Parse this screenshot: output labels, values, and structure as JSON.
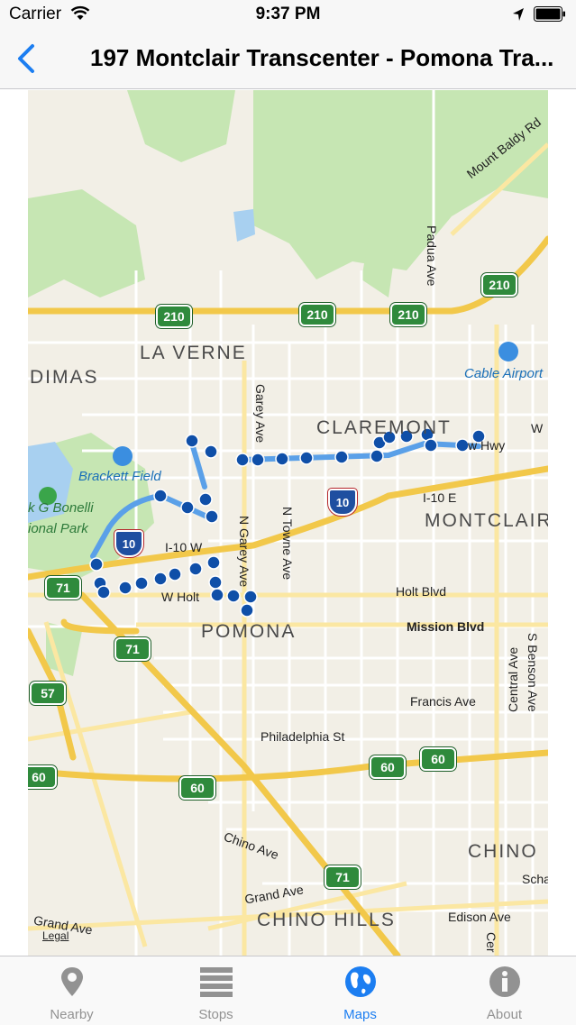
{
  "status_bar": {
    "carrier": "Carrier",
    "time": "9:37 PM",
    "icons": [
      "wifi-icon",
      "location-arrow-icon",
      "battery-icon"
    ]
  },
  "nav": {
    "back_icon": "chevron-left-icon",
    "title": "197 Montclair Transcenter - Pomona Tra..."
  },
  "map": {
    "cities": [
      "LA VERNE",
      "DIMAS",
      "CLAREMONT",
      "MONTCLAIR",
      "POMONA",
      "CHINO",
      "CHINO HILLS"
    ],
    "places": [
      "Brackett Field",
      "Cable Airport",
      "k G Bonelli",
      "ional Park"
    ],
    "roads": [
      "Mount Baldy Rd",
      "Padua Ave",
      "Garey Ave",
      "N Garey Ave",
      "N Towne Ave",
      "I-10 E",
      "I-10 W",
      "W Holt",
      "Holt Blvd",
      "Mission Blvd",
      "Central Ave",
      "S Benson Ave",
      "Francis Ave",
      "Philadelphia St",
      "Chino Ave",
      "Grand Ave",
      "Edison Ave",
      "Grand Ave",
      "Scha",
      "W",
      "w Hwy",
      "Cer"
    ],
    "highway_shields": [
      "210",
      "210",
      "210",
      "210",
      "71",
      "71",
      "57",
      "60",
      "60",
      "60",
      "60",
      "71"
    ],
    "interstate_shields": [
      "10",
      "10"
    ],
    "legal": "Legal",
    "colors": {
      "route": "#0f4fa8",
      "route_line": "#5aa0e8",
      "freeway": "#f6cb45",
      "park": "#c6e6b3",
      "water": "#a8d0f0"
    }
  },
  "tabs": [
    {
      "label": "Nearby",
      "icon": "map-pin-icon",
      "active": false
    },
    {
      "label": "Stops",
      "icon": "list-icon",
      "active": false
    },
    {
      "label": "Maps",
      "icon": "globe-icon",
      "active": true
    },
    {
      "label": "About",
      "icon": "info-icon",
      "active": false
    }
  ]
}
